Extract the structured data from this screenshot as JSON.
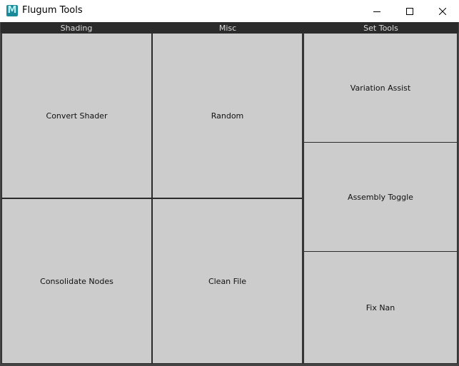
{
  "window": {
    "title": "Flugum Tools",
    "icon": "maya-m-icon",
    "icon_letter": "M"
  },
  "columns": [
    {
      "header": "Shading",
      "buttons": [
        "Convert Shader",
        "Consolidate Nodes"
      ]
    },
    {
      "header": "Misc",
      "buttons": [
        "Random",
        "Clean File"
      ]
    },
    {
      "header": "Set Tools",
      "buttons": [
        "Variation Assist",
        "Assembly Toggle",
        "Fix Nan"
      ]
    }
  ],
  "colors": {
    "background": "#444444",
    "header_bar": "#2b2b2b",
    "button_face": "#cccccc",
    "titlebar": "#ffffff",
    "icon_accent": "#1a8a9a"
  }
}
